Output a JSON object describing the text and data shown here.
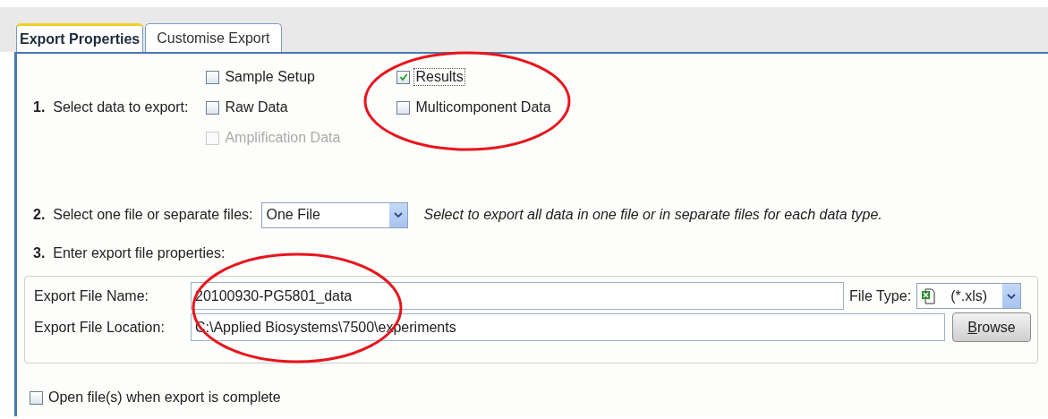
{
  "tabs": [
    {
      "label": "Export Properties",
      "selected": true
    },
    {
      "label": "Customise Export",
      "selected": false
    }
  ],
  "step1": {
    "number": "1.",
    "label": "Select data to export:",
    "options": [
      {
        "label": "Sample Setup",
        "checked": false,
        "disabled": false,
        "focused": false
      },
      {
        "label": "Results",
        "checked": true,
        "disabled": false,
        "focused": true
      },
      {
        "label": "Raw Data",
        "checked": false,
        "disabled": false,
        "focused": false
      },
      {
        "label": "Multicomponent Data",
        "checked": false,
        "disabled": false,
        "focused": false
      },
      {
        "label": "Amplification Data",
        "checked": false,
        "disabled": true,
        "focused": false
      }
    ]
  },
  "step2": {
    "number": "2.",
    "label": "Select one file or separate files:",
    "dropdown": "One File",
    "hint": "Select to export all data in one file or in separate files for each data type."
  },
  "step3": {
    "number": "3.",
    "label": "Enter export file properties:",
    "file_name_label": "Export File Name:",
    "file_name": "20100930-PG5801_data",
    "file_type_label": "File Type:",
    "file_type": "(*.xls)",
    "location_label": "Export File Location:",
    "location": "C:\\Applied Biosystems\\7500\\experiments",
    "browse_button": {
      "label": "Browse",
      "mnemonic": true
    }
  },
  "open_when_complete": {
    "label": "Open file(s) when export is complete",
    "checked": false
  }
}
